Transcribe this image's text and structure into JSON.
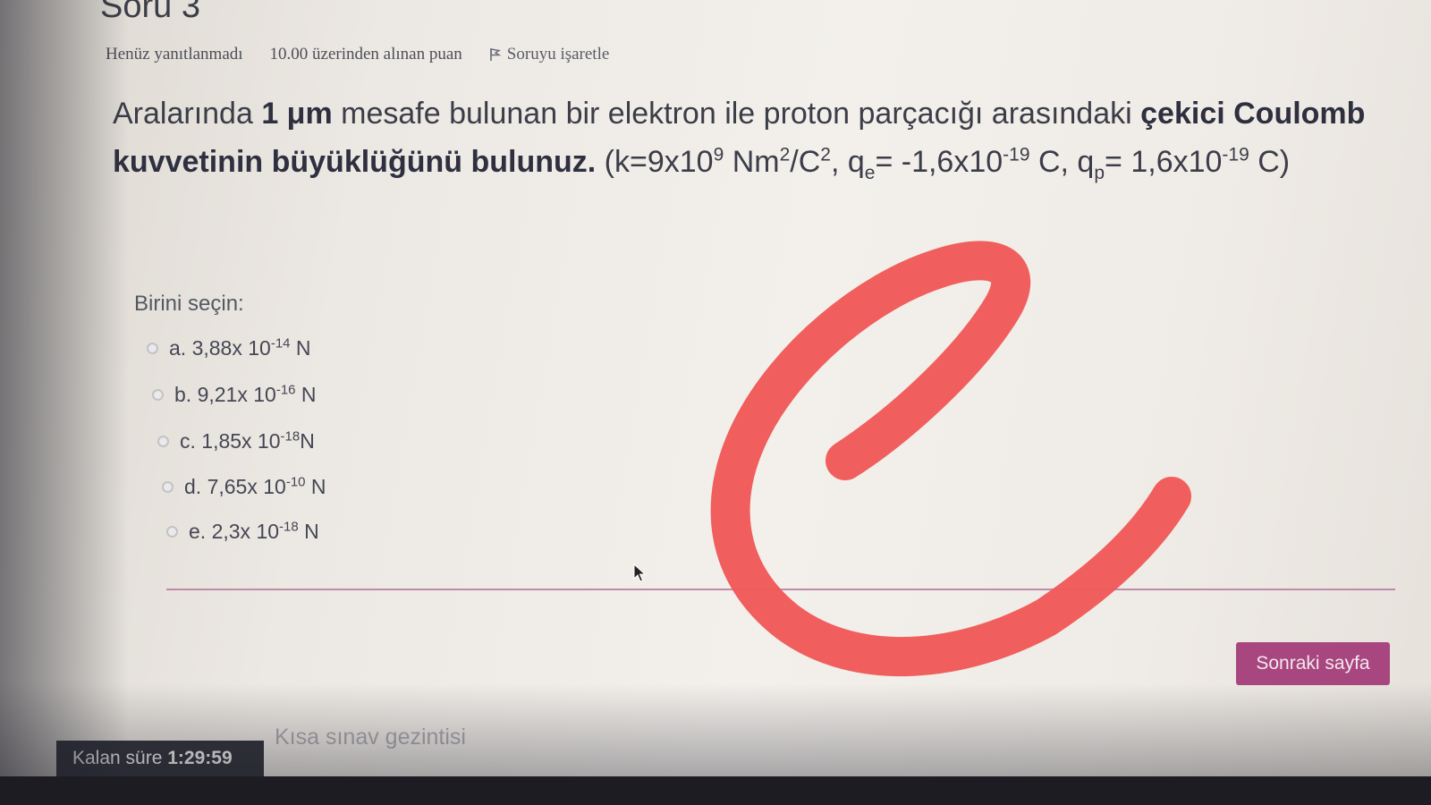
{
  "question": {
    "title": "Soru 3",
    "status": "Henüz yanıtlanmadı",
    "points": "10.00 üzerinden alınan puan",
    "flag_label": "Soruyu işaretle",
    "text": {
      "part1": "Aralarında ",
      "bold1": "1 μm",
      "part2": " mesafe bulunan bir elektron ile proton parçacığı arasındaki ",
      "bold2": "çekici Coulomb kuvvetinin büyüklüğünü bulunuz.",
      "k_prefix": " (k=9x10",
      "k_exp": "9",
      "k_unit": " Nm",
      "k_unit_exp": "2",
      "k_unit2": "/C",
      "k_unit2_exp": "2",
      "qe_label": ", q",
      "qe_sub": "e",
      "qe_value": "= -1,6x10",
      "qe_exp": "-19",
      "qe_unit": " C, q",
      "qp_sub": "p",
      "qp_value": "= 1,6x10",
      "qp_exp": "-19",
      "qp_unit": " C)"
    }
  },
  "answers": {
    "prompt": "Birini seçin:",
    "options": [
      {
        "letter": "a.",
        "mantissa": "3,88x 10",
        "exp": "-14",
        "unit": "N"
      },
      {
        "letter": "b.",
        "mantissa": "9,21x 10",
        "exp": "-16",
        "unit": "N"
      },
      {
        "letter": "c.",
        "mantissa": "1,85x 10",
        "exp": "-18",
        "unit": "N"
      },
      {
        "letter": "d.",
        "mantissa": "7,65x 10",
        "exp": "-10",
        "unit": "N"
      },
      {
        "letter": "e.",
        "mantissa": "2,3x 10",
        "exp": "-18",
        "unit": "N"
      }
    ]
  },
  "footer": {
    "next_button": "Sonraki sayfa",
    "nav_link": "Kısa sınav gezintisi",
    "timer_label": "Kalan süre ",
    "timer_value": "1:29:59"
  },
  "annotation": {
    "handwritten_mark": "e",
    "color": "#ef5a58"
  },
  "colors": {
    "accent": "#a8477f",
    "divider": "#c28aaa",
    "timer_bg": "#30323a"
  }
}
